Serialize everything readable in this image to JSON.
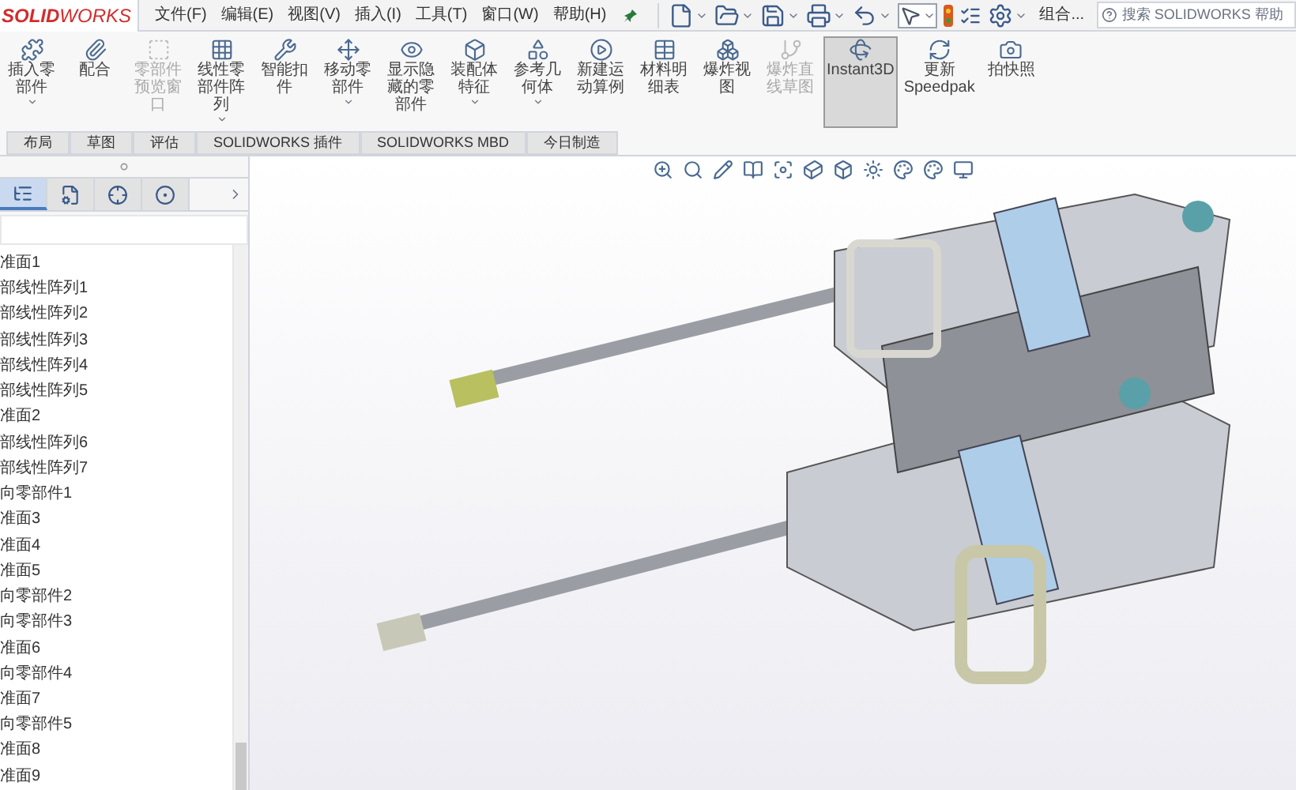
{
  "app": {
    "logo_bold": "SOLID",
    "logo_light": "WORKS"
  },
  "menu": [
    "文件(F)",
    "编辑(E)",
    "视图(V)",
    "插入(I)",
    "工具(T)",
    "窗口(W)",
    "帮助(H)"
  ],
  "quick_toolbar": {
    "config_label": "组合...",
    "search_placeholder": "搜索 SOLIDWORKS 帮助"
  },
  "ribbon": [
    {
      "label": "插入零部件",
      "dropdown": true,
      "disabled": false,
      "selected": false
    },
    {
      "label": "配合",
      "dropdown": false,
      "disabled": false,
      "selected": false
    },
    {
      "label": "零部件预览窗口",
      "dropdown": false,
      "disabled": true,
      "selected": false
    },
    {
      "label": "线性零部件阵列",
      "dropdown": true,
      "disabled": false,
      "selected": false
    },
    {
      "label": "智能扣件",
      "dropdown": false,
      "disabled": false,
      "selected": false
    },
    {
      "label": "移动零部件",
      "dropdown": true,
      "disabled": false,
      "selected": false
    },
    {
      "label": "显示隐藏的零部件",
      "dropdown": false,
      "disabled": false,
      "selected": false
    },
    {
      "label": "装配体特征",
      "dropdown": true,
      "disabled": false,
      "selected": false
    },
    {
      "label": "参考几何体",
      "dropdown": true,
      "disabled": false,
      "selected": false
    },
    {
      "label": "新建运动算例",
      "dropdown": false,
      "disabled": false,
      "selected": false
    },
    {
      "label": "材料明细表",
      "dropdown": false,
      "disabled": false,
      "selected": false
    },
    {
      "label": "爆炸视图",
      "dropdown": false,
      "disabled": false,
      "selected": false
    },
    {
      "label": "爆炸直线草图",
      "dropdown": false,
      "disabled": true,
      "selected": false
    },
    {
      "label": "Instant3D",
      "dropdown": false,
      "disabled": false,
      "selected": true
    },
    {
      "label": "更新 Speedpak",
      "dropdown": false,
      "disabled": false,
      "selected": false
    },
    {
      "label": "拍快照",
      "dropdown": false,
      "disabled": false,
      "selected": false
    }
  ],
  "tabs": [
    {
      "label": "布局",
      "selected": false
    },
    {
      "label": "草图",
      "selected": false
    },
    {
      "label": "评估",
      "selected": false
    },
    {
      "label": "SOLIDWORKS 插件",
      "selected": false
    },
    {
      "label": "SOLIDWORKS MBD",
      "selected": false
    },
    {
      "label": "今日制造",
      "selected": false
    }
  ],
  "panel_tabs": [
    {
      "selected": true
    },
    {
      "selected": false
    },
    {
      "selected": false
    },
    {
      "selected": false
    }
  ],
  "feature_tree": {
    "items": [
      "准面1",
      "部线性阵列1",
      "部线性阵列2",
      "部线性阵列3",
      "部线性阵列4",
      "部线性阵列5",
      "准面2",
      "部线性阵列6",
      "部线性阵列7",
      "向零部件1",
      "准面3",
      "准面4",
      "准面5",
      "向零部件2",
      "向零部件3",
      "准面6",
      "向零部件4",
      "准面7",
      "向零部件5",
      "准面8",
      "准面9"
    ]
  }
}
